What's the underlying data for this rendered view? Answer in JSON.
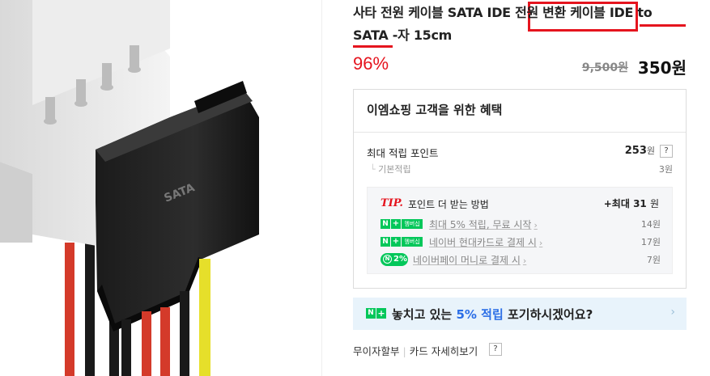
{
  "product": {
    "title": "사타 전원 케이블 SATA IDE 전원 변환 케이블 IDE to SATA -자 15cm",
    "discount": "96%",
    "original_price": "9,500원",
    "price": "350원"
  },
  "image": {
    "connector_label": "SATA"
  },
  "benefit": {
    "title": "이엠쇼핑 고객을 위한 혜택",
    "max_points_label": "최대 적립 포인트",
    "max_points_value": "253",
    "max_points_unit": "원",
    "help_glyph": "?",
    "basic_label": "기본적립",
    "basic_value": "3원",
    "tip": {
      "label": "TIP.",
      "text": "포인트 더 받는 방법",
      "max_prefix": "+최대",
      "max_value": "31",
      "max_unit": "원",
      "rows": [
        {
          "label": "최대 5% 적립, 무료 시작",
          "value": "14원",
          "badge": "멤버십"
        },
        {
          "label": "네이버 현대카드로 결제 시",
          "value": "17원",
          "badge": "멤버십"
        },
        {
          "label": "네이버페이 머니로 결제 시",
          "value": "7원",
          "badge": "2%"
        }
      ]
    }
  },
  "banner": {
    "text_before": "놓치고 있는 ",
    "highlight": "5% 적립",
    "text_after": " 포기하시겠어요?"
  },
  "footer": {
    "link1": "무이자할부",
    "link2": "카드 자세히보기"
  },
  "colors": {
    "accent_red": "#e5141e",
    "naver_green": "#03c75a",
    "banner_blue": "#2b6ee6"
  }
}
